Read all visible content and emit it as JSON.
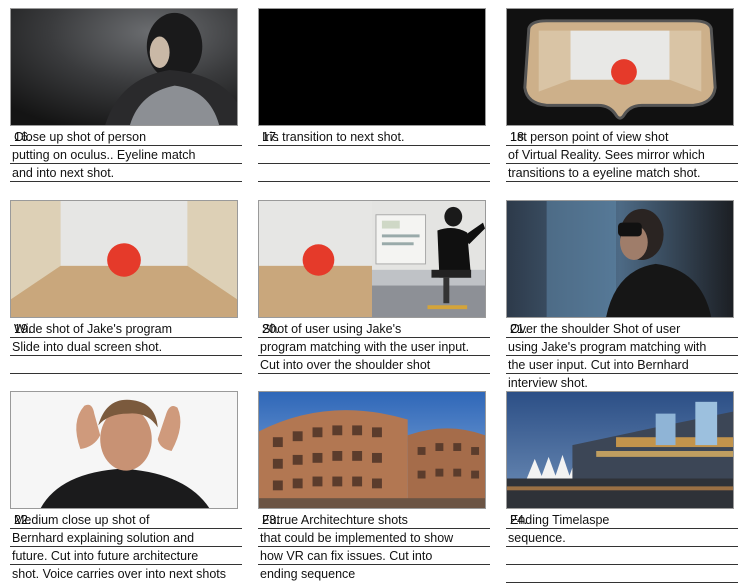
{
  "shots": [
    {
      "number": "16.",
      "lines": [
        "Close up shot of person",
        "putting on oculus.. Eyeline match",
        "and into next shot.",
        ""
      ]
    },
    {
      "number": "17.",
      "lines": [
        "Iris transition to next shot.",
        "",
        "",
        ""
      ]
    },
    {
      "number": "18.",
      "lines": [
        "1st person point of view shot",
        "of Virtual Reality. Sees mirror which",
        "transitions to a eyeline match shot.",
        ""
      ]
    },
    {
      "number": "19.",
      "lines": [
        "Wide shot of Jake's program",
        "Slide into dual screen shot.",
        "",
        ""
      ]
    },
    {
      "number": "20.",
      "lines": [
        "Shot of user using Jake's",
        "program matching with the user input.",
        "Cut into over the shoulder shot",
        ""
      ]
    },
    {
      "number": "21.",
      "lines": [
        "Over the shoulder Shot of user",
        "using Jake's program matching with",
        "the user input. Cut into Bernhard",
        "interview shot."
      ]
    },
    {
      "number": "22.",
      "lines": [
        "Medium close up shot of",
        "Bernhard explaining solution and",
        "future. Cut into future architecture",
        "shot. Voice carries over into next shots"
      ]
    },
    {
      "number": "23.",
      "lines": [
        "Futrue Architechture shots",
        "that could be implemented to show",
        "how VR can fix issues. Cut into",
        "ending sequence"
      ]
    },
    {
      "number": "24.",
      "lines": [
        "Ending Timelaspe",
        "sequence.",
        "",
        ""
      ]
    }
  ],
  "colors": {
    "room_wall": "#e6e6e4",
    "room_floor": "#c9a77c",
    "room_side": "#d8c8ac",
    "red_dot": "#e53a2a"
  }
}
